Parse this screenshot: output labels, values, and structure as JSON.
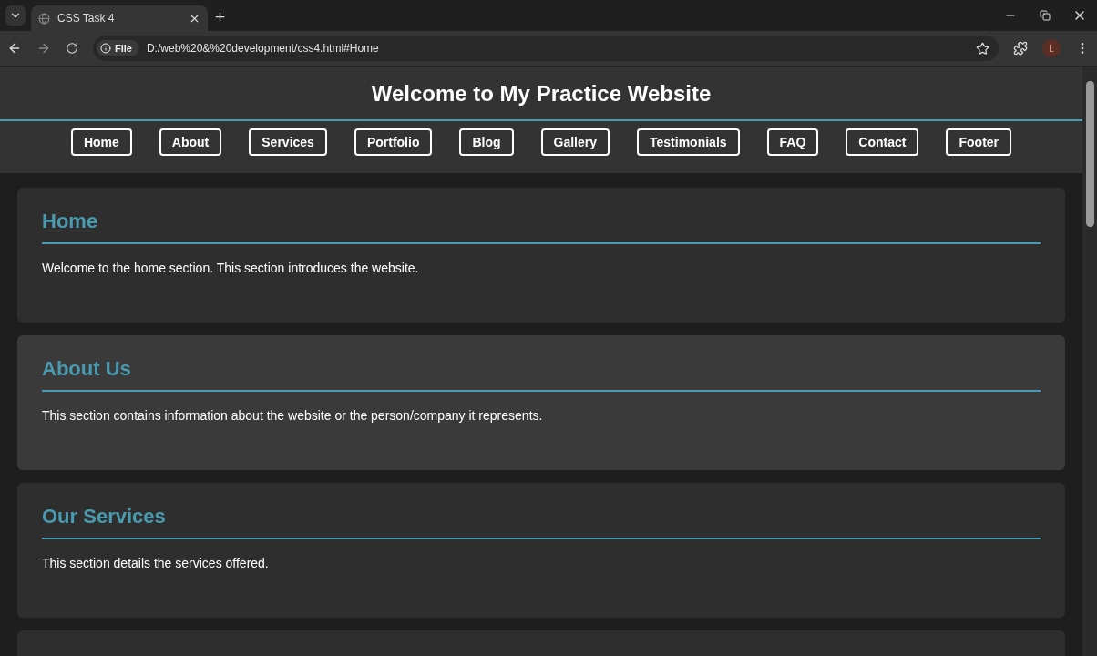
{
  "browser": {
    "tab_title": "CSS Task 4",
    "address_chip": "File",
    "url": "D:/web%20&%20development/css4.html#Home",
    "profile_initial": "L"
  },
  "header": {
    "title": "Welcome to My Practice Website"
  },
  "nav": [
    {
      "label": "Home"
    },
    {
      "label": "About"
    },
    {
      "label": "Services"
    },
    {
      "label": "Portfolio"
    },
    {
      "label": "Blog"
    },
    {
      "label": "Gallery"
    },
    {
      "label": "Testimonials"
    },
    {
      "label": "FAQ"
    },
    {
      "label": "Contact"
    },
    {
      "label": "Footer"
    }
  ],
  "sections": [
    {
      "heading": "Home",
      "text": "Welcome to the home section. This section introduces the website."
    },
    {
      "heading": "About Us",
      "text": "This section contains information about the website or the person/company it represents."
    },
    {
      "heading": "Our Services",
      "text": "This section details the services offered."
    }
  ]
}
